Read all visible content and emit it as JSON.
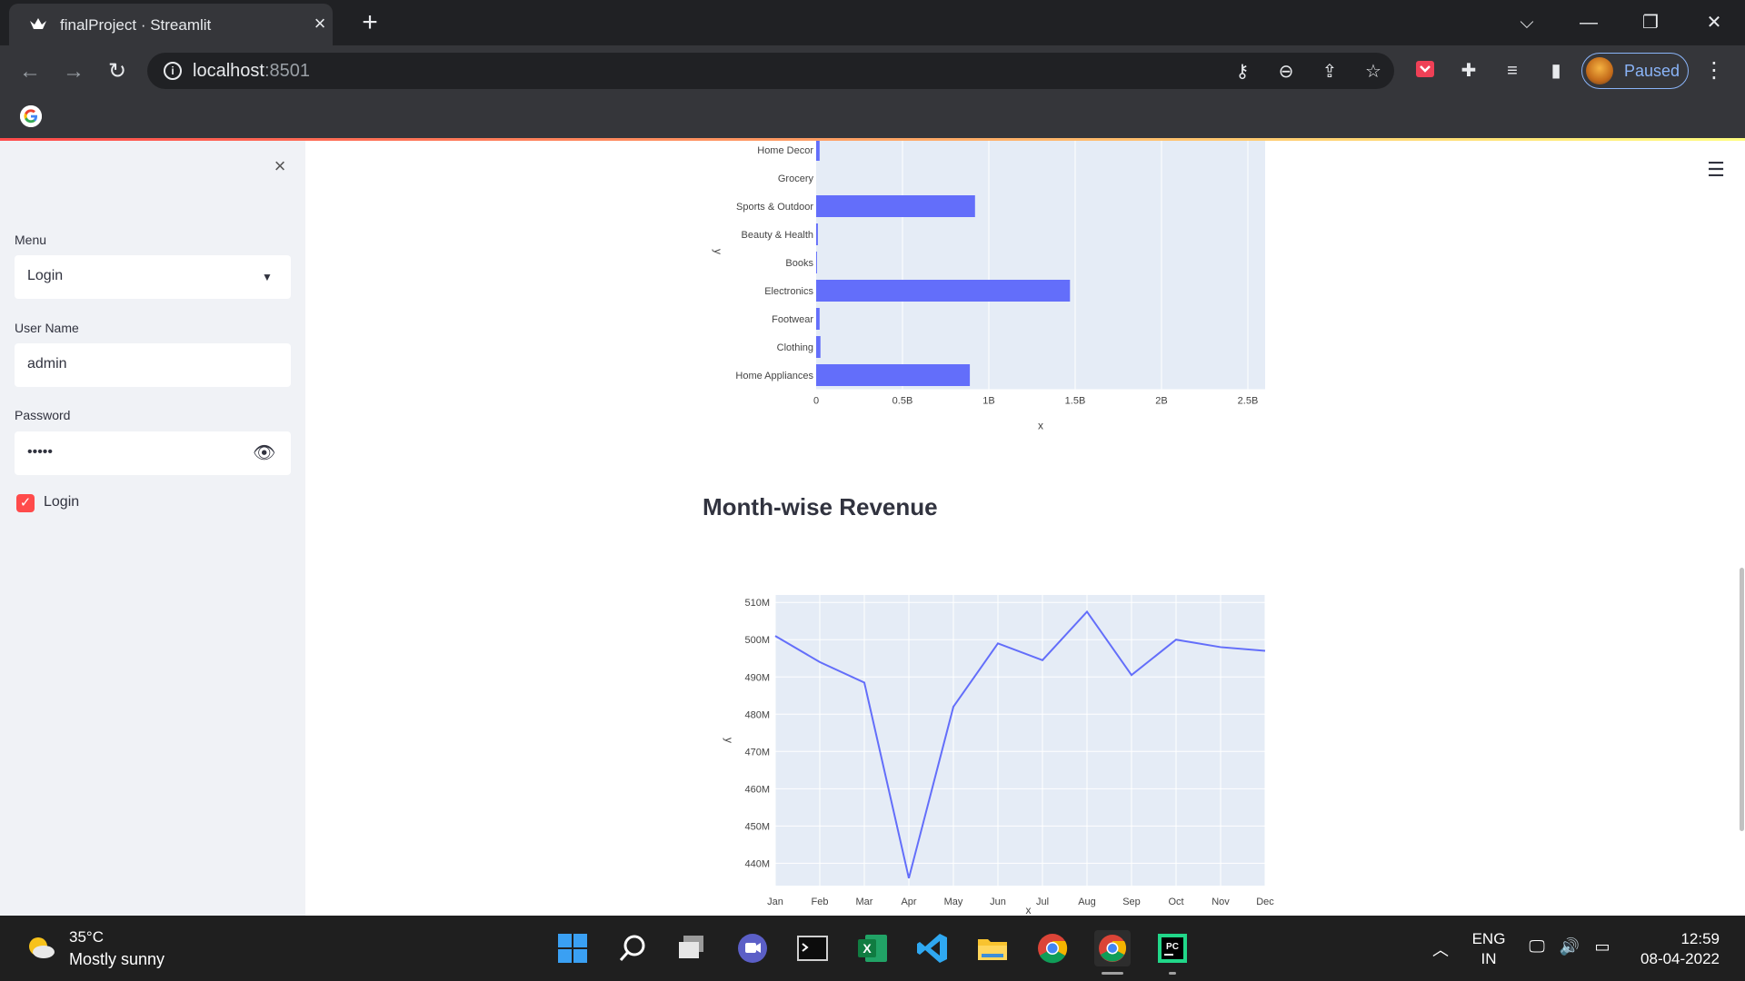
{
  "browser": {
    "tab_title": "finalProject · Streamlit",
    "tab_close": "×",
    "new_tab": "+",
    "url_host": "localhost",
    "url_port": ":8501",
    "profile_label": "Paused"
  },
  "sidebar": {
    "close": "×",
    "menu_label": "Menu",
    "menu_value": "Login",
    "username_label": "User Name",
    "username_value": "admin",
    "password_label": "Password",
    "password_value": "•••••",
    "login_checkbox_label": "Login",
    "login_checked": true
  },
  "main": {
    "section_title": "Month-wise Revenue"
  },
  "chart_data": [
    {
      "type": "bar",
      "orientation": "horizontal",
      "categories": [
        "Home Decor",
        "Grocery",
        "Sports & Outdoor",
        "Beauty & Health",
        "Books",
        "Electronics",
        "Footwear",
        "Clothing",
        "Home Appliances"
      ],
      "values": [
        0.02,
        0.0,
        0.92,
        0.01,
        0.005,
        1.47,
        0.02,
        0.025,
        0.89
      ],
      "value_unit": "B",
      "xlabel": "x",
      "ylabel": "y",
      "xlim": [
        0,
        2.6
      ],
      "xticks": [
        "0",
        "0.5B",
        "1B",
        "1.5B",
        "2B",
        "2.5B"
      ],
      "xtick_values": [
        0,
        0.5,
        1,
        1.5,
        2,
        2.5
      ],
      "bar_color": "#636efa",
      "plot_bg": "#e5ecf6",
      "grid": true
    },
    {
      "type": "line",
      "title": "Month-wise Revenue",
      "x": [
        "Jan",
        "Feb",
        "Mar",
        "Apr",
        "May",
        "Jun",
        "Jul",
        "Aug",
        "Sep",
        "Oct",
        "Nov",
        "Dec"
      ],
      "y": [
        501,
        494,
        488.5,
        436,
        482,
        499,
        494.5,
        507.5,
        490.5,
        500,
        498,
        497
      ],
      "value_unit": "M",
      "xlabel": "x",
      "ylabel": "y",
      "ylim": [
        434,
        512
      ],
      "yticks": [
        "440M",
        "450M",
        "460M",
        "470M",
        "480M",
        "490M",
        "500M",
        "510M"
      ],
      "ytick_values": [
        440,
        450,
        460,
        470,
        480,
        490,
        500,
        510
      ],
      "line_color": "#636efa",
      "plot_bg": "#e5ecf6",
      "grid": true
    }
  ],
  "taskbar": {
    "weather_temp": "35°C",
    "weather_desc": "Mostly sunny",
    "lang_1": "ENG",
    "lang_2": "IN",
    "time": "12:59",
    "date": "08-04-2022"
  }
}
